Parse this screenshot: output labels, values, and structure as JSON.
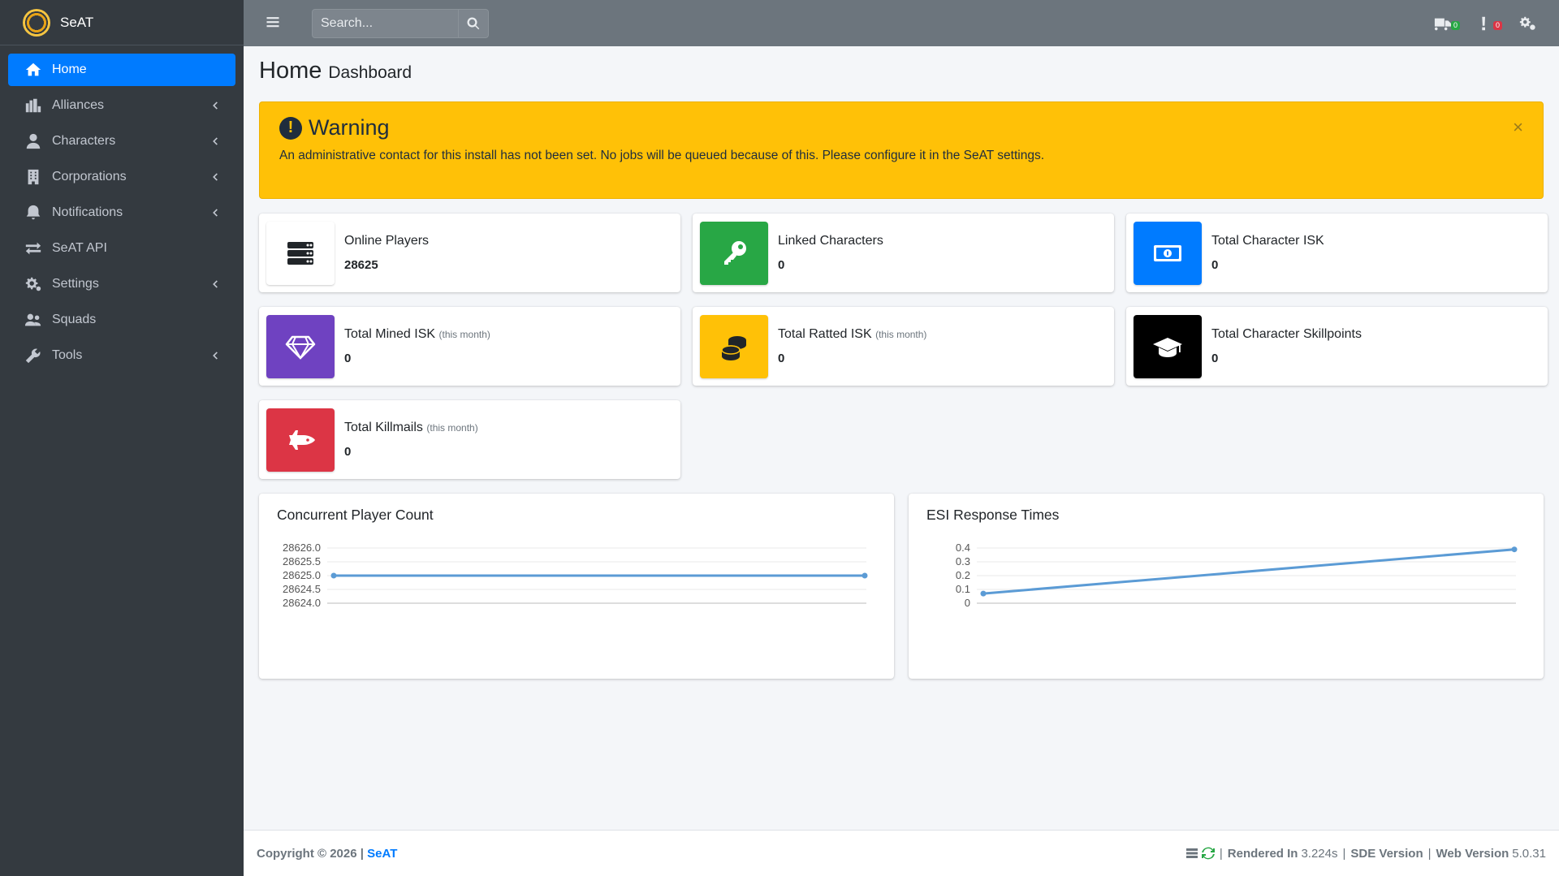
{
  "app": {
    "name": "SeAT"
  },
  "sidebar": {
    "items": [
      {
        "label": "Home",
        "icon": "home-icon",
        "active": true,
        "has_children": false
      },
      {
        "label": "Alliances",
        "icon": "alliance-icon",
        "active": false,
        "has_children": true
      },
      {
        "label": "Characters",
        "icon": "user-icon",
        "active": false,
        "has_children": true
      },
      {
        "label": "Corporations",
        "icon": "building-icon",
        "active": false,
        "has_children": true
      },
      {
        "label": "Notifications",
        "icon": "bell-icon",
        "active": false,
        "has_children": true
      },
      {
        "label": "SeAT API",
        "icon": "exchange-icon",
        "active": false,
        "has_children": false
      },
      {
        "label": "Settings",
        "icon": "cogs-icon",
        "active": false,
        "has_children": true
      },
      {
        "label": "Squads",
        "icon": "users-icon",
        "active": false,
        "has_children": false
      },
      {
        "label": "Tools",
        "icon": "wrench-icon",
        "active": false,
        "has_children": true
      }
    ]
  },
  "topbar": {
    "search_placeholder": "Search...",
    "queue_badge": "0",
    "error_badge": "0"
  },
  "page": {
    "title": "Home",
    "subtitle": "Dashboard"
  },
  "alert": {
    "title": "Warning",
    "message": "An administrative contact for this install has not been set. No jobs will be queued because of this. Please configure it in the SeAT settings.",
    "close": "×"
  },
  "boxes": [
    {
      "label": "Online Players",
      "suffix": "",
      "value": "28625",
      "icon": "server-icon",
      "color": "#ffffff"
    },
    {
      "label": "Linked Characters",
      "suffix": "",
      "value": "0",
      "icon": "key-icon",
      "color": "#28a745"
    },
    {
      "label": "Total Character ISK",
      "suffix": "",
      "value": "0",
      "icon": "money-bill-icon",
      "color": "#007bff"
    },
    {
      "label": "Total Mined ISK",
      "suffix": "(this month)",
      "value": "0",
      "icon": "gem-icon",
      "color": "#6f42c1"
    },
    {
      "label": "Total Ratted ISK",
      "suffix": "(this month)",
      "value": "0",
      "icon": "coins-icon",
      "color": "#ffc107"
    },
    {
      "label": "Total Character Skillpoints",
      "suffix": "",
      "value": "0",
      "icon": "graduation-cap-icon",
      "color": "#000000"
    },
    {
      "label": "Total Killmails",
      "suffix": "(this month)",
      "value": "0",
      "icon": "space-shuttle-icon",
      "color": "#dc3545"
    }
  ],
  "chart_data": [
    {
      "type": "line",
      "title": "Concurrent Player Count",
      "x": [
        0,
        1
      ],
      "series": [
        {
          "values": [
            28625,
            28625
          ]
        }
      ],
      "ylim": [
        28624.0,
        28626.0
      ],
      "yticks": [
        "28626.0",
        "28625.5",
        "28625.0",
        "28624.5",
        "28624.0"
      ],
      "grid": true,
      "color": "#5b9bd5"
    },
    {
      "type": "line",
      "title": "ESI Response Times",
      "x": [
        0,
        1
      ],
      "series": [
        {
          "values": [
            0.07,
            0.39
          ]
        }
      ],
      "ylim": [
        0,
        0.4
      ],
      "yticks": [
        "0.4",
        "0.3",
        "0.2",
        "0.1",
        "0"
      ],
      "grid": true,
      "color": "#5b9bd5"
    }
  ],
  "footer": {
    "copyright": "Copyright © 2026 |",
    "brand": "SeAT",
    "rendered_label": "Rendered In",
    "rendered_value": "3.224s",
    "sde_label": "SDE Version",
    "web_label": "Web Version",
    "web_value": "5.0.31"
  }
}
